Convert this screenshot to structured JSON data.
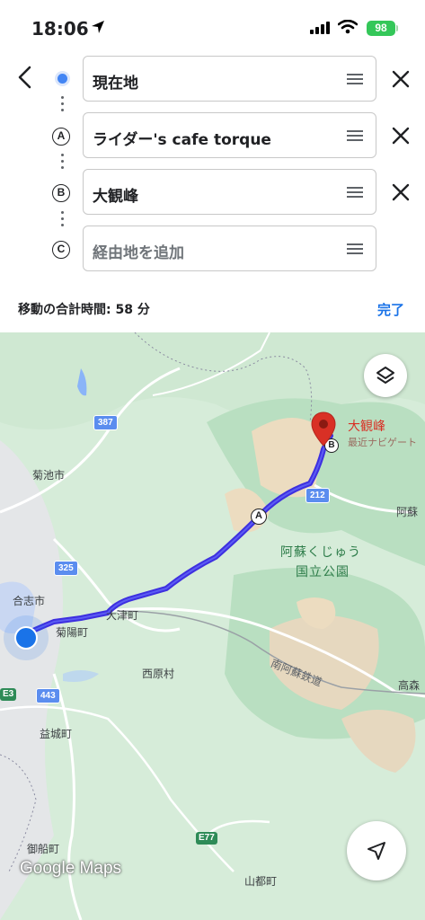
{
  "status": {
    "time": "18:06",
    "battery": "98"
  },
  "route": {
    "stops": [
      {
        "marker": "",
        "value": "現在地"
      },
      {
        "marker": "A",
        "value": "ライダー's cafe torque"
      },
      {
        "marker": "B",
        "value": "大観峰"
      }
    ],
    "add_stop_placeholder": "経由地を追加",
    "total_time": "移動の合計時間: 58 分",
    "done_label": "完了"
  },
  "map": {
    "destination": "大観峰",
    "destination_sub": "最近ナビゲート",
    "places": [
      "菊池市",
      "合志市",
      "大津町",
      "菊陽町",
      "西原村",
      "益城町",
      "御船町",
      "山都町",
      "高森",
      "阿蘇"
    ],
    "park": [
      "阿蘇くじゅう",
      "国立公園"
    ],
    "railway": "南阿蘇鉄道",
    "roads": [
      "387",
      "325",
      "212",
      "443",
      "E77",
      "E3"
    ],
    "waypoint_markers": [
      "A",
      "B"
    ],
    "logo": "Google Maps",
    "colors": {
      "route": "#3d2fe0",
      "accent": "#1a73e8",
      "pin": "#d93025"
    }
  }
}
